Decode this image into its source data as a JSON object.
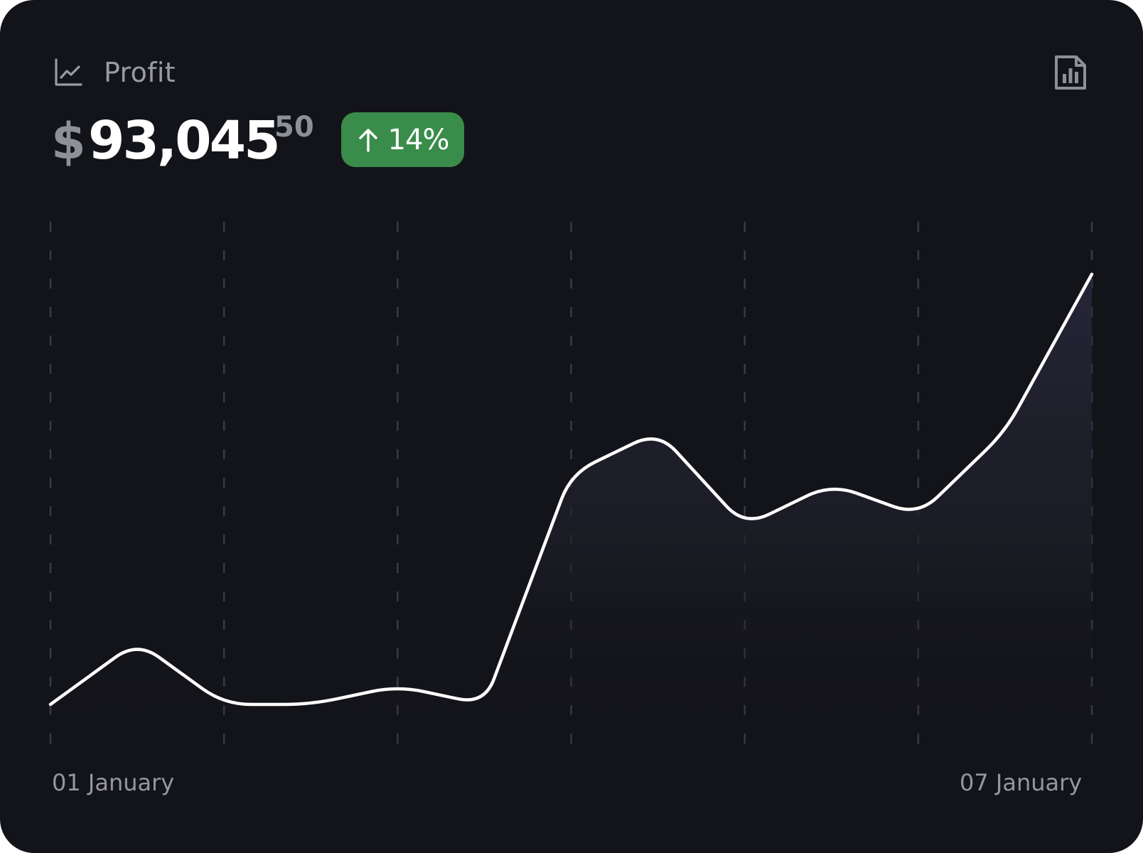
{
  "card": {
    "title": "Profit",
    "header_icon": "line-chart-icon",
    "action_icon": "bar-chart-report-icon",
    "value": {
      "currency": "$",
      "amount": "93,045",
      "cents": "50"
    },
    "change": {
      "direction_icon": "arrow-up-icon",
      "label": "14%",
      "color": "#3a8c4a"
    }
  },
  "chart_data": {
    "type": "area",
    "x_start_label": "01 January",
    "x_end_label": "07 January",
    "x": [
      1,
      1.5,
      2,
      2.5,
      3,
      3.5,
      4,
      4.5,
      5,
      5.5,
      6,
      6.5,
      7
    ],
    "values": [
      8,
      20,
      8,
      8,
      11.5,
      8,
      52,
      60,
      42,
      50,
      44,
      60,
      90
    ],
    "ylim": [
      0,
      100
    ],
    "grid": "vertical-dashed",
    "line_color": "#ffffff",
    "fill_color": "#262639",
    "background": "#131419"
  }
}
